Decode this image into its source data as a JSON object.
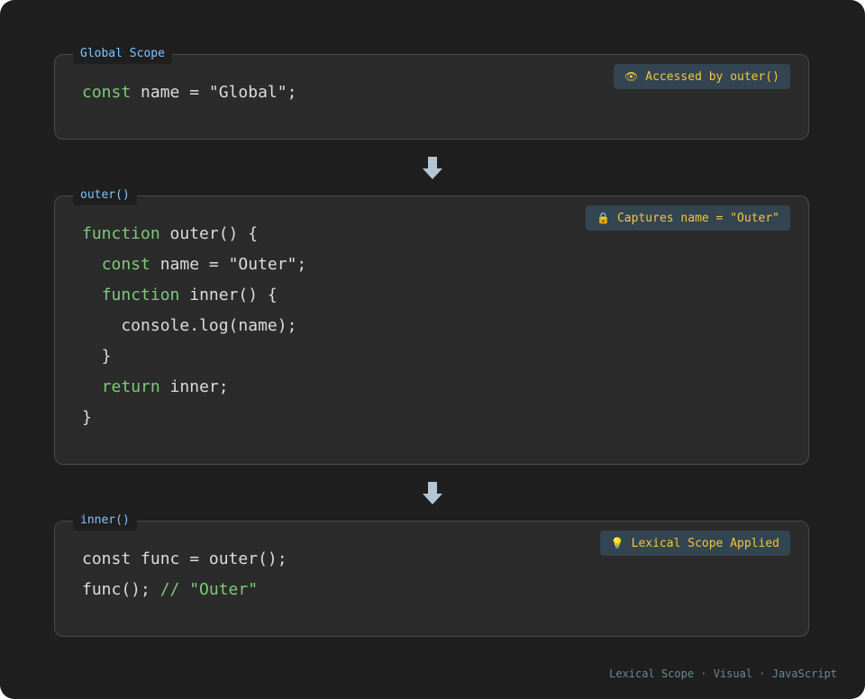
{
  "global_scope": {
    "tab": "Global Scope",
    "badge_icon": "eye-icon",
    "badge": "Accessed by outer()",
    "code": [
      [
        {
          "t": "const",
          "c": "kw"
        },
        {
          "t": " name = \"Global\";",
          "c": ""
        }
      ]
    ]
  },
  "outer_scope": {
    "tab": "outer()",
    "badge_icon": "lock-icon",
    "badge": "Captures name = \"Outer\"",
    "code": [
      [
        {
          "t": "function",
          "c": "kw"
        },
        {
          "t": " outer() {",
          "c": ""
        }
      ],
      [
        {
          "t": "  ",
          "c": ""
        },
        {
          "t": "const",
          "c": "kw"
        },
        {
          "t": " name = \"Outer\";",
          "c": ""
        }
      ],
      [
        {
          "t": "  ",
          "c": ""
        },
        {
          "t": "function",
          "c": "kw"
        },
        {
          "t": " inner() {",
          "c": ""
        }
      ],
      [
        {
          "t": "    console.log(name);",
          "c": ""
        }
      ],
      [
        {
          "t": "  }",
          "c": ""
        }
      ],
      [
        {
          "t": "  ",
          "c": ""
        },
        {
          "t": "return",
          "c": "kw"
        },
        {
          "t": " inner;",
          "c": ""
        }
      ],
      [
        {
          "t": "}",
          "c": ""
        }
      ]
    ]
  },
  "inner_scope": {
    "tab": "inner()",
    "badge_icon": "lightbulb-icon",
    "badge": "Lexical Scope Applied",
    "code": [
      [
        {
          "t": "const func = outer();",
          "c": ""
        }
      ],
      [
        {
          "t": "func(); ",
          "c": ""
        },
        {
          "t": "// \"Outer\"",
          "c": "cm"
        }
      ]
    ]
  },
  "arrows": [
    "down-arrow-icon",
    "down-arrow-icon"
  ],
  "footer": "Lexical Scope · Visual · JavaScript",
  "colors": {
    "background": "#1f1f1f",
    "panel": "#2b2b2b",
    "keyword": "#7ec97a",
    "tab_label": "#7fc4ff",
    "badge_text": "#f5c542",
    "badge_bg": "#334550"
  }
}
